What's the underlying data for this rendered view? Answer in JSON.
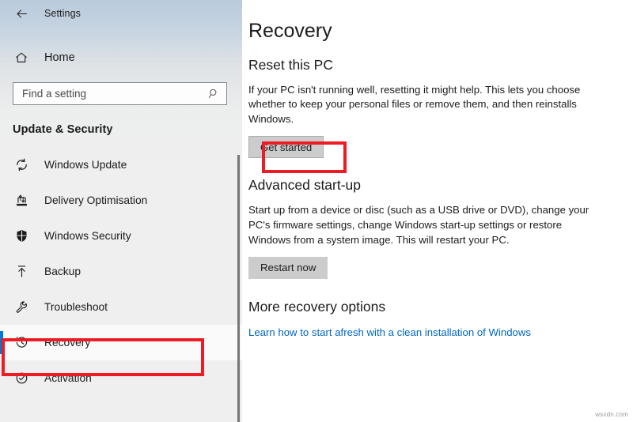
{
  "window": {
    "title": "Settings",
    "back_icon": "back-arrow-icon"
  },
  "sidebar": {
    "home": {
      "label": "Home",
      "icon": "home-icon"
    },
    "search": {
      "placeholder": "Find a setting",
      "value": "",
      "icon": "search-icon"
    },
    "section_title": "Update & Security",
    "items": [
      {
        "label": "Windows Update",
        "icon": "refresh-circle-icon",
        "selected": false
      },
      {
        "label": "Delivery Optimisation",
        "icon": "delivery-optimisation-icon",
        "selected": false
      },
      {
        "label": "Windows Security",
        "icon": "shield-icon",
        "selected": false
      },
      {
        "label": "Backup",
        "icon": "upload-arrow-icon",
        "selected": false
      },
      {
        "label": "Troubleshoot",
        "icon": "wrench-icon",
        "selected": false
      },
      {
        "label": "Recovery",
        "icon": "clock-history-icon",
        "selected": true
      },
      {
        "label": "Activation",
        "icon": "check-circle-icon",
        "selected": false
      }
    ]
  },
  "main": {
    "page_title": "Recovery",
    "sections": [
      {
        "heading": "Reset this PC",
        "body": "If your PC isn't running well, resetting it might help. This lets you choose whether to keep your personal files or remove them, and then reinstalls Windows.",
        "button": "Get started"
      },
      {
        "heading": "Advanced start-up",
        "body": "Start up from a device or disc (such as a USB drive or DVD), change your PC's firmware settings, change Windows start-up settings or restore Windows from a system image. This will restart your PC.",
        "button": "Restart now"
      },
      {
        "heading": "More recovery options",
        "link": "Learn how to start afresh with a clean installation of Windows"
      }
    ]
  },
  "annotations": {
    "color": "#ed1c24",
    "targets": [
      "Recovery",
      "Get started"
    ]
  },
  "watermark": "wsxdn.com"
}
